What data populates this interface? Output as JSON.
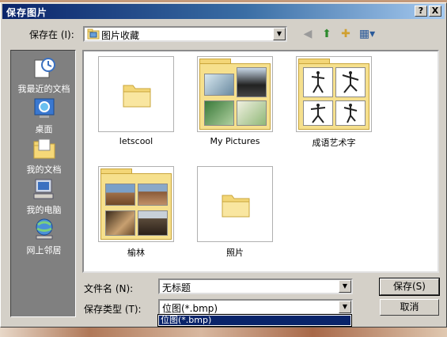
{
  "window": {
    "title": "保存图片",
    "help_button": "?",
    "close_button": "X"
  },
  "location": {
    "label": "保存在 (I):",
    "value": "图片收藏"
  },
  "places": [
    {
      "label": "我最近的文档"
    },
    {
      "label": "桌面"
    },
    {
      "label": "我的文档"
    },
    {
      "label": "我的电脑"
    },
    {
      "label": "网上邻居"
    }
  ],
  "files": [
    {
      "name": "letscool"
    },
    {
      "name": "My Pictures"
    },
    {
      "name": "成语艺术字"
    },
    {
      "name": "榆林"
    },
    {
      "name": "照片"
    }
  ],
  "form": {
    "filename_label": "文件名 (N):",
    "filename_value": "无标题",
    "filetype_label": "保存类型 (T):",
    "filetype_value": "位图(*.bmp)",
    "save_label": "保存(S)",
    "cancel_label": "取消"
  },
  "dropdown": {
    "options": [
      "位图(*.bmp)"
    ]
  }
}
